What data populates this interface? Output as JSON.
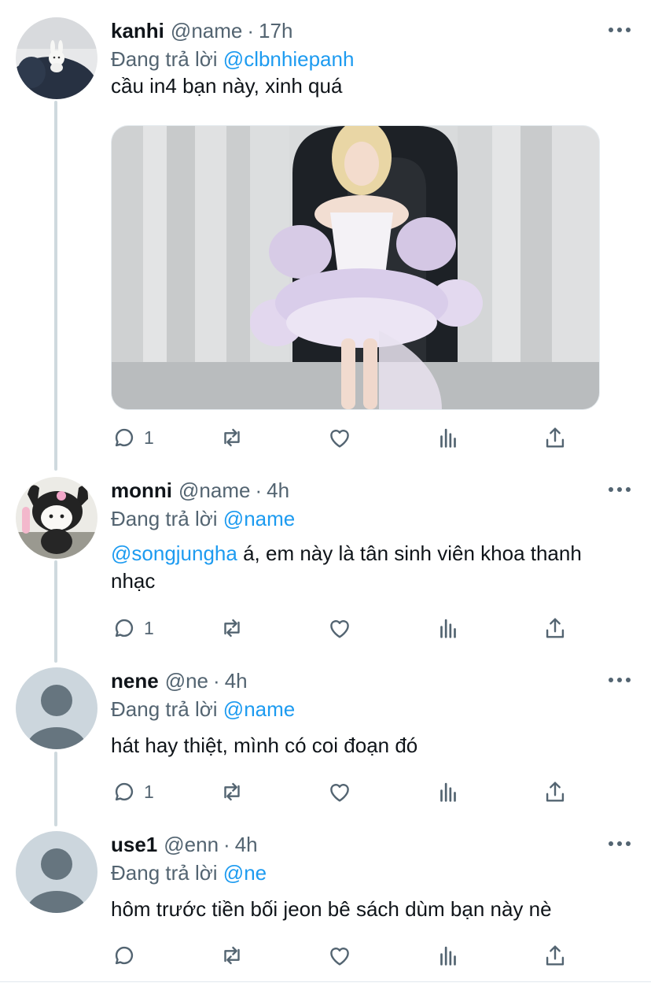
{
  "reply_prefix": "Đang trả lời",
  "colors": {
    "mention": "#1d9bf0",
    "secondary": "#536471",
    "thread_line": "#cfd9de"
  },
  "tweets": [
    {
      "name": "kanhi",
      "handle": "@name",
      "separator": "·",
      "time": "17h",
      "reply_to": "@clbnhiepanh",
      "text_mention": "",
      "text": "cầu in4 bạn này, xinh quá",
      "media": "photo",
      "reply_count": "1",
      "avatar": "plush-bunny-avatar"
    },
    {
      "name": "monni",
      "handle": "@name",
      "separator": "·",
      "time": "4h",
      "reply_to": "@name",
      "text_mention": "@songjungha",
      "text": " á, em này là tân sinh viên khoa thanh nhạc",
      "media": "",
      "reply_count": "1",
      "avatar": "kuromi-plush-avatar"
    },
    {
      "name": "nene",
      "handle": "@ne",
      "separator": "·",
      "time": "4h",
      "reply_to": "@name",
      "text_mention": "",
      "text": "hát hay thiệt, mình có coi đoạn đó",
      "media": "",
      "reply_count": "1",
      "avatar": "default-avatar"
    },
    {
      "name": "use1",
      "handle": "@enn",
      "separator": "·",
      "time": "4h",
      "reply_to": "@ne",
      "text_mention": "",
      "text": "hôm trước tiền bối jeon bê sách dùm bạn này nè",
      "media": "",
      "reply_count": "",
      "avatar": "default-avatar"
    }
  ]
}
